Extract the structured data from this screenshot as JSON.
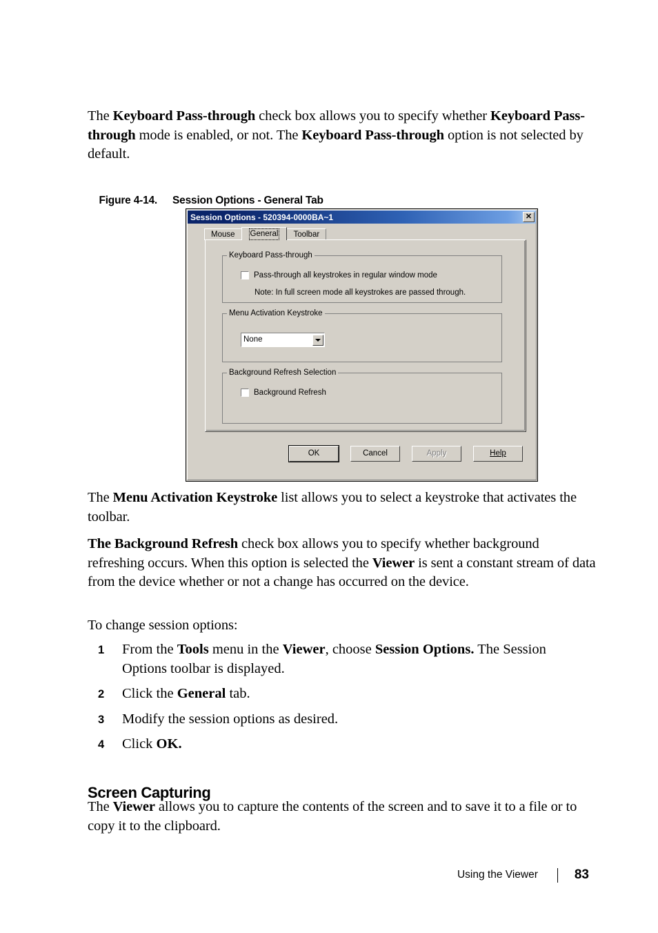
{
  "page": {
    "intro_paragraph": {
      "parts": [
        {
          "t": "The ",
          "b": false
        },
        {
          "t": "Keyboard Pass-through",
          "b": true
        },
        {
          "t": " check box allows you to specify whether ",
          "b": false
        },
        {
          "t": "Keyboard Pass-through",
          "b": true
        },
        {
          "t": " mode is enabled, or not. The ",
          "b": false
        },
        {
          "t": "Keyboard Pass-through",
          "b": true
        },
        {
          "t": " option is not selected by default.",
          "b": false
        }
      ]
    },
    "figure_caption": {
      "number": "Figure 4-14.",
      "title": "Session Options - General Tab"
    },
    "menu_paragraph": {
      "parts": [
        {
          "t": "The ",
          "b": false
        },
        {
          "t": "Menu Activation Keystroke",
          "b": true
        },
        {
          "t": " list allows you to select a keystroke that activates the toolbar.",
          "b": false
        }
      ]
    },
    "background_refresh_paragraph": {
      "parts": [
        {
          "t": "The Background Refresh",
          "b": true
        },
        {
          "t": " check box allows you to specify whether background refreshing occurs. When this option is selected the ",
          "b": false
        },
        {
          "t": "Viewer",
          "b": true
        },
        {
          "t": " is sent a constant stream of data from the device whether or not a change has occurred on the device.",
          "b": false
        }
      ]
    },
    "to_change_lead_in": "To change session options:",
    "steps": [
      {
        "number": "1",
        "parts": [
          {
            "t": "From the ",
            "b": false
          },
          {
            "t": "Tools",
            "b": true
          },
          {
            "t": " menu in the ",
            "b": false
          },
          {
            "t": "Viewer",
            "b": true
          },
          {
            "t": ", choose ",
            "b": false
          },
          {
            "t": "Session Options.",
            "b": true
          },
          {
            "t": " The Session Options toolbar is displayed.",
            "b": false
          }
        ]
      },
      {
        "number": "2",
        "parts": [
          {
            "t": "Click the ",
            "b": false
          },
          {
            "t": "General",
            "b": true
          },
          {
            "t": " tab.",
            "b": false
          }
        ]
      },
      {
        "number": "3",
        "parts": [
          {
            "t": "Modify the session options as desired.",
            "b": false
          }
        ]
      },
      {
        "number": "4",
        "parts": [
          {
            "t": "Click ",
            "b": false
          },
          {
            "t": "OK.",
            "b": true
          }
        ]
      }
    ],
    "section_heading": "Screen Capturing",
    "capture_paragraph": {
      "parts": [
        {
          "t": "The ",
          "b": false
        },
        {
          "t": "Viewer",
          "b": true
        },
        {
          "t": " allows you to capture the contents of the screen and to save it to a file or to copy it to the clipboard.",
          "b": false
        }
      ]
    },
    "footer": {
      "label": "Using the Viewer",
      "page_number": "83"
    }
  },
  "dialog": {
    "title": "Session Options - 520394-0000BA~1",
    "close_glyph": "✕",
    "tabs": [
      {
        "label": "Mouse",
        "selected": false
      },
      {
        "label": "General",
        "selected": true
      },
      {
        "label": "Toolbar",
        "selected": false
      }
    ],
    "groups": {
      "keyboard_passthrough": {
        "legend": "Keyboard Pass-through",
        "checkbox_label": "Pass-through all keystrokes in regular window mode",
        "checkbox_checked": false,
        "note": "Note: In full screen mode all keystrokes are passed through."
      },
      "menu_activation": {
        "legend": "Menu Activation Keystroke",
        "combo_value": "None"
      },
      "background_refresh": {
        "legend": "Background Refresh Selection",
        "checkbox_label": "Background Refresh",
        "checkbox_checked": false
      }
    },
    "buttons": [
      {
        "label": "OK",
        "state": "default"
      },
      {
        "label": "Cancel",
        "state": "normal"
      },
      {
        "label": "Apply",
        "state": "disabled"
      },
      {
        "label": "Help",
        "state": "normal",
        "mnemonic": "H"
      }
    ],
    "colors": {
      "face": "#d4d0c8",
      "title_start": "#0a246a",
      "title_end": "#a6c8f0",
      "disabled_text": "#808080"
    }
  }
}
